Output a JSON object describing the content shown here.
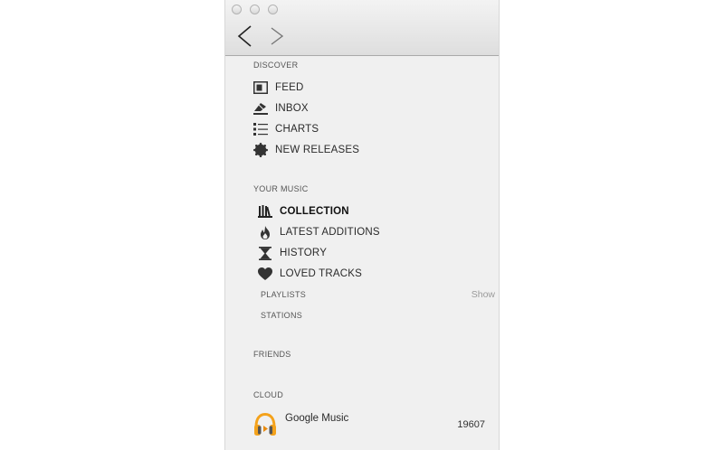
{
  "sections": {
    "discover": {
      "header": "DISCOVER",
      "items": [
        {
          "label": "FEED",
          "icon": "feed-icon"
        },
        {
          "label": "INBOX",
          "icon": "inbox-icon"
        },
        {
          "label": "CHARTS",
          "icon": "charts-icon"
        },
        {
          "label": "NEW RELEASES",
          "icon": "new-releases-icon"
        }
      ]
    },
    "your_music": {
      "header": "YOUR MUSIC",
      "items": [
        {
          "label": "COLLECTION",
          "icon": "collection-icon",
          "active": true
        },
        {
          "label": "LATEST ADDITIONS",
          "icon": "flame-icon"
        },
        {
          "label": "HISTORY",
          "icon": "hourglass-icon"
        },
        {
          "label": "LOVED TRACKS",
          "icon": "heart-icon"
        }
      ],
      "playlists_label": "PLAYLISTS",
      "show_label": "Show",
      "stations_label": "STATIONS"
    },
    "friends": {
      "header": "FRIENDS"
    },
    "cloud": {
      "header": "CLOUD",
      "source": {
        "label": "Google Music",
        "count": "19607",
        "icon": "google-music-headphones-icon"
      }
    }
  },
  "colors": {
    "sidebar_bg": "#f0f0f0",
    "cloud_icon": "#f4a21b"
  }
}
